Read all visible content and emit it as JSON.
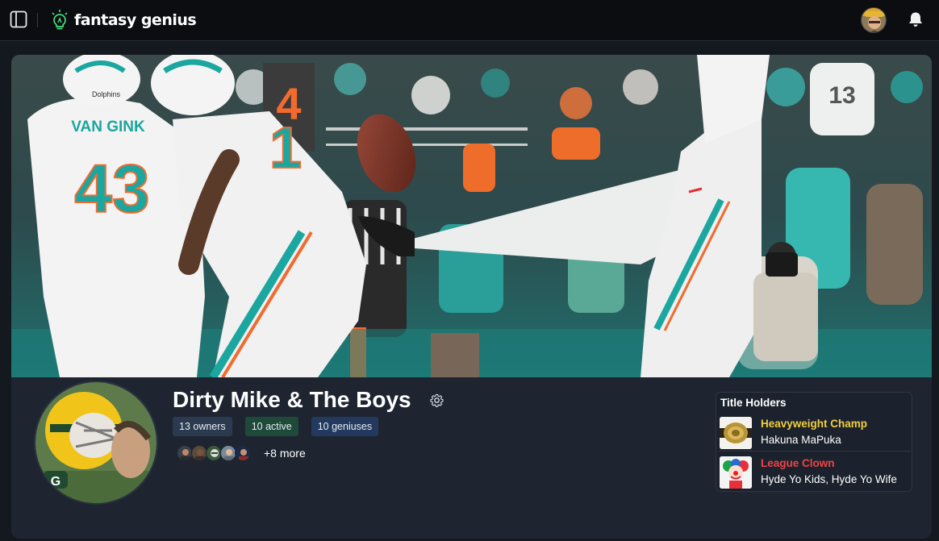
{
  "header": {
    "logo_text": "fantasy genius",
    "icons": [
      "sidebar-toggle-icon",
      "lightbulb-icon",
      "bell-icon"
    ]
  },
  "banner": {
    "jersey_numbers": [
      "43",
      "4",
      "13"
    ],
    "player_name_on_jersey": "VAN GINK",
    "helmet_text": "Dolphins"
  },
  "league": {
    "name": "Dirty Mike & The Boys",
    "badges": {
      "owners": "13 owners",
      "active": "10 active",
      "geniuses": "10 geniuses"
    },
    "more_members": "+8 more"
  },
  "title_holders": {
    "heading": "Title Holders",
    "items": [
      {
        "title": "Heavyweight Champ",
        "team": "Hakuna MaPuka",
        "color": "#f2cf3c"
      },
      {
        "title": "League Clown",
        "team": "Hyde Yo Kids, Hyde Yo Wife",
        "color": "#ef4444"
      }
    ]
  },
  "colors": {
    "topbar_bg": "#0b0d11",
    "page_bg": "#141920",
    "card_bg": "#1e2531",
    "logo_accent": "#4ade80",
    "dolphins_aqua": "#1ba6a0",
    "dolphins_orange": "#f26a2e"
  }
}
